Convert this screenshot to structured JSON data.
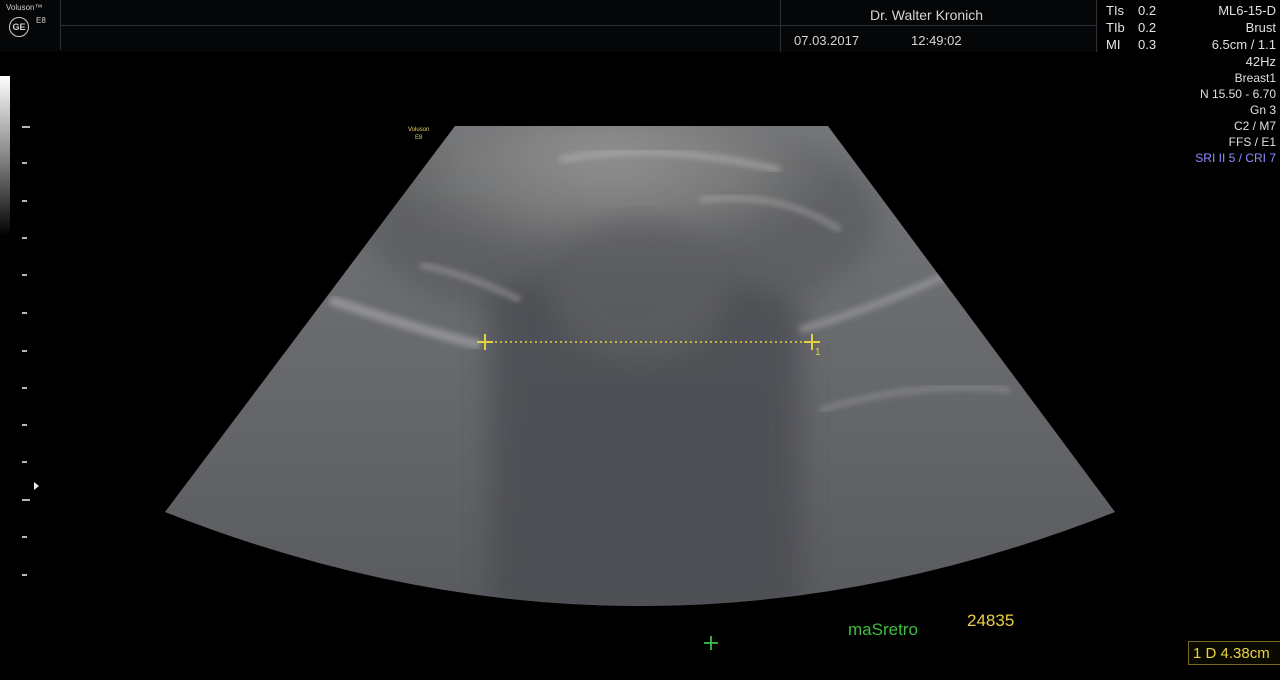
{
  "header": {
    "brand_logo_text": "Voluson™",
    "brand_model": "E8",
    "ge_logo": "GE",
    "operator": "Dr. Walter Kronich",
    "date": "07.03.2017",
    "time": "12:49:02"
  },
  "safety_indices": [
    {
      "label": "TIs",
      "value": "0.2"
    },
    {
      "label": "TIb",
      "value": "0.2"
    },
    {
      "label": "MI",
      "value": "0.3"
    }
  ],
  "probe_info": {
    "probe": "ML6-15-D",
    "application": "Brust",
    "depth_gain": "6.5cm / 1.1",
    "frame_rate": "42Hz",
    "preset": "Breast1",
    "frequency": "N 15.50 - 6.70",
    "gain": "Gn  3",
    "map": "C2 / M7",
    "ffs": "FFS / E1",
    "sri_cri": "SRI II 5 / CRI 7"
  },
  "image_overlay": {
    "mini_logo": "Voluson",
    "mini_model": "E8",
    "caliper_index": "1"
  },
  "annotation": {
    "label": "maSretro",
    "number": "24835"
  },
  "measurement": {
    "result": "1 D 4.38cm"
  },
  "colors": {
    "caliper": "#e6d23c",
    "annotation_text": "#3dbf3d",
    "number_text": "#e9d23f",
    "sri_text": "#8f8fff"
  },
  "icons": [
    "ge-logo-icon",
    "caliper-cross-icon",
    "cursor-cross-icon",
    "focus-marker-icon"
  ]
}
